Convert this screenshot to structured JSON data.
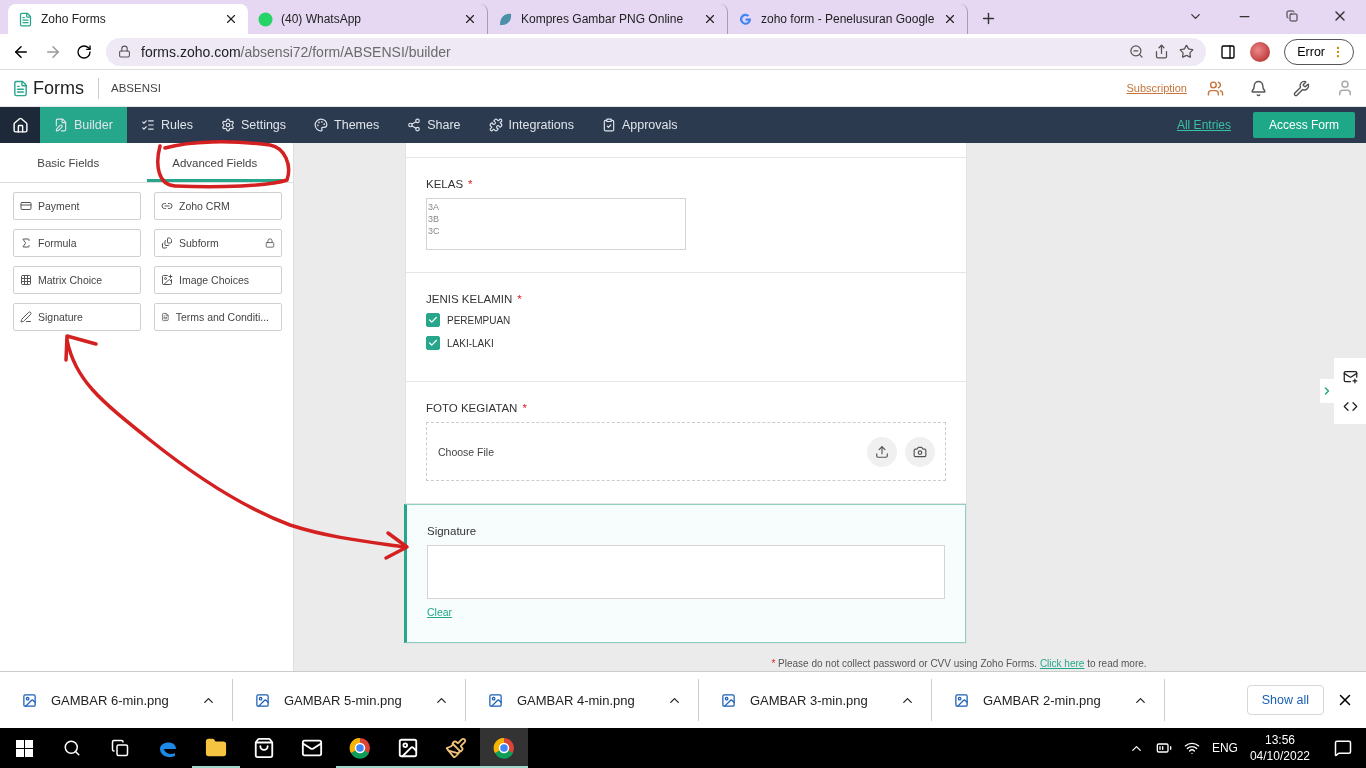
{
  "browser_tabs": [
    {
      "title": "Zoho Forms",
      "kind": "zoho",
      "selected": true
    },
    {
      "title": "(40) WhatsApp",
      "kind": "whatsapp",
      "selected": false
    },
    {
      "title": "Kompres Gambar PNG Online",
      "kind": "compress",
      "selected": false
    },
    {
      "title": "zoho form - Penelusuran Google",
      "kind": "google",
      "selected": false
    }
  ],
  "address_bar": {
    "url_host": "forms.zoho.com",
    "url_path": "/absensi72/form/ABSENSI/builder",
    "profile_button": "Error"
  },
  "app_header": {
    "logo": "Forms",
    "form_name": "ABSENSI",
    "subscription_link": "Subscription"
  },
  "nav": {
    "items": [
      {
        "label": "Builder",
        "kind": "builder",
        "selected": true
      },
      {
        "label": "Rules",
        "kind": "rules",
        "selected": false
      },
      {
        "label": "Settings",
        "kind": "settings",
        "selected": false
      },
      {
        "label": "Themes",
        "kind": "themes",
        "selected": false
      },
      {
        "label": "Share",
        "kind": "share",
        "selected": false
      },
      {
        "label": "Integrations",
        "kind": "integrations",
        "selected": false
      },
      {
        "label": "Approvals",
        "kind": "approvals",
        "selected": false
      }
    ],
    "all_entries": "All Entries",
    "access_form": "Access Form"
  },
  "sidebar": {
    "tabs": [
      {
        "label": "Basic Fields",
        "selected": false
      },
      {
        "label": "Advanced Fields",
        "selected": true
      }
    ],
    "fields": [
      {
        "label": "Payment",
        "kind": "payment",
        "locked": false
      },
      {
        "label": "Zoho CRM",
        "kind": "crm",
        "locked": false
      },
      {
        "label": "Formula",
        "kind": "formula",
        "locked": false
      },
      {
        "label": "Subform",
        "kind": "subform",
        "locked": true
      },
      {
        "label": "Matrix Choice",
        "kind": "matrix",
        "locked": false
      },
      {
        "label": "Image Choices",
        "kind": "image",
        "locked": false
      },
      {
        "label": "Signature",
        "kind": "signature",
        "locked": false
      },
      {
        "label": "Terms and Conditi...",
        "kind": "terms",
        "locked": false
      }
    ]
  },
  "form": {
    "fields": [
      {
        "kind": "listbox",
        "label": "KELAS",
        "required": true,
        "selected": false,
        "options": [
          "3A",
          "3B",
          "3C"
        ]
      },
      {
        "kind": "checkbox",
        "label": "JENIS KELAMIN",
        "required": true,
        "selected": false,
        "options": [
          {
            "label": "PEREMPUAN",
            "checked": true
          },
          {
            "label": "LAKI-LAKI",
            "checked": true
          }
        ]
      },
      {
        "kind": "file",
        "label": "FOTO KEGIATAN",
        "required": true,
        "selected": false,
        "placeholder": "Choose File"
      },
      {
        "kind": "signature",
        "label": "Signature",
        "required": false,
        "selected": true,
        "clear_link": "Clear"
      }
    ],
    "note": {
      "mark": "*",
      "before": "Please do not collect password or CVV using Zoho Forms.",
      "link": "Click here",
      "after": "to read more."
    }
  },
  "downloads": {
    "items": [
      "GAMBAR 6-min.png",
      "GAMBAR 5-min.png",
      "GAMBAR 4-min.png",
      "GAMBAR 3-min.png",
      "GAMBAR 2-min.png"
    ],
    "show_all": "Show all"
  },
  "taskbar": {
    "apps": [
      {
        "kind": "edge",
        "running": false,
        "selected": false
      },
      {
        "kind": "explorer",
        "running": true,
        "selected": false
      },
      {
        "kind": "store",
        "running": false,
        "selected": false
      },
      {
        "kind": "mail",
        "running": false,
        "selected": false
      },
      {
        "kind": "chrome_profile",
        "running": true,
        "selected": false
      },
      {
        "kind": "photos",
        "running": true,
        "selected": false
      },
      {
        "kind": "paint",
        "running": true,
        "selected": false
      },
      {
        "kind": "chrome",
        "running": true,
        "selected": true
      }
    ],
    "language": "ENG",
    "time": "13:56",
    "date": "04/10/2022"
  }
}
